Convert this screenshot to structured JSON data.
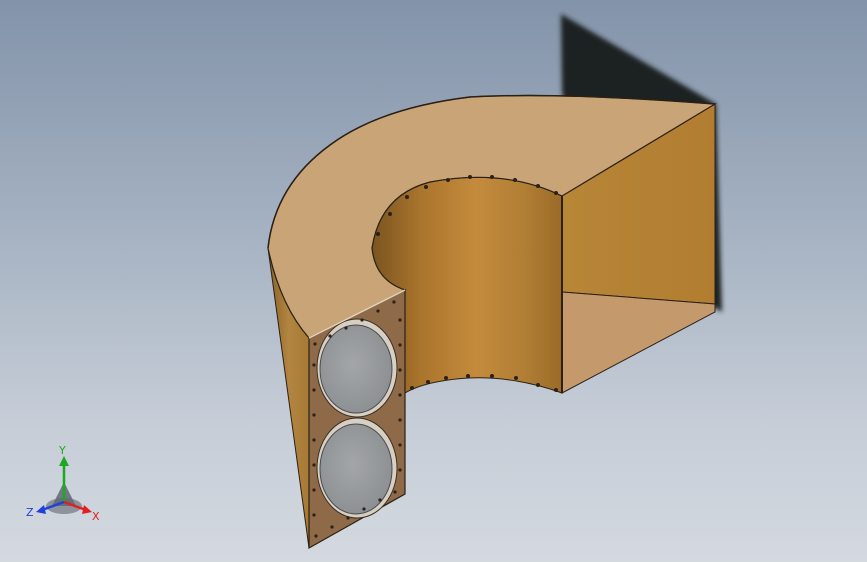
{
  "viewport": {
    "background_top": "#8393a9",
    "background_bottom": "#d4d9e0"
  },
  "model": {
    "material_color": "#b6843a",
    "top_face_color": "#c9a477",
    "end_panel_color": "#8f6a48",
    "speaker_cone_color": "#9b9ea1",
    "fastener_color": "#2a2118",
    "shadow_color": "#1e2022",
    "speaker_count": 2
  },
  "triad": {
    "labels": {
      "x": "X",
      "y": "Y",
      "z": "Z"
    },
    "colors": {
      "x": "#e02020",
      "y": "#1fa81f",
      "z": "#2040d8"
    }
  }
}
